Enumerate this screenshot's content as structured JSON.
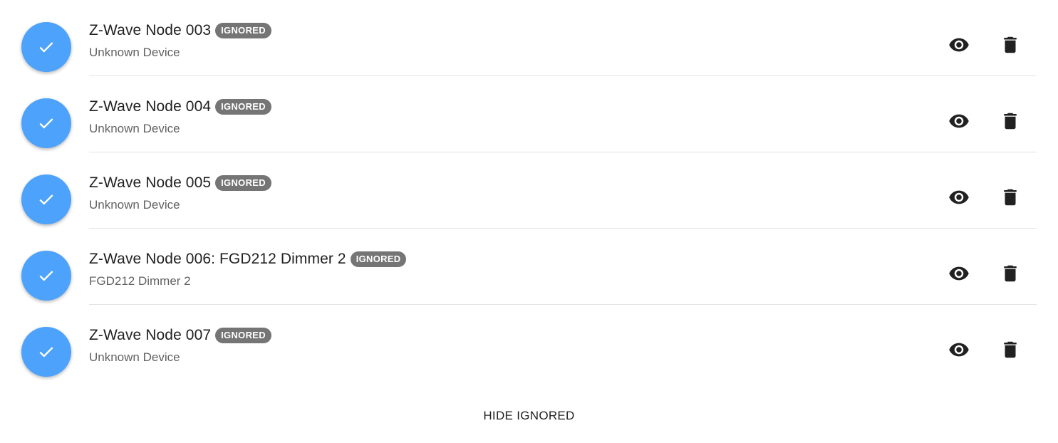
{
  "devices": [
    {
      "title": "Z-Wave Node 003",
      "badge": "IGNORED",
      "subtitle": "Unknown Device"
    },
    {
      "title": "Z-Wave Node 004",
      "badge": "IGNORED",
      "subtitle": "Unknown Device"
    },
    {
      "title": "Z-Wave Node 005",
      "badge": "IGNORED",
      "subtitle": "Unknown Device"
    },
    {
      "title": "Z-Wave Node 006: FGD212 Dimmer 2",
      "badge": "IGNORED",
      "subtitle": "FGD212 Dimmer 2"
    },
    {
      "title": "Z-Wave Node 007",
      "badge": "IGNORED",
      "subtitle": "Unknown Device"
    }
  ],
  "footer": {
    "hide_ignored_label": "HIDE IGNORED"
  },
  "icons": {
    "avatar": "check-icon",
    "show": "eye-icon",
    "delete": "trash-icon"
  },
  "colors": {
    "avatar_bg": "#4da3fb",
    "badge_bg": "#757575"
  }
}
